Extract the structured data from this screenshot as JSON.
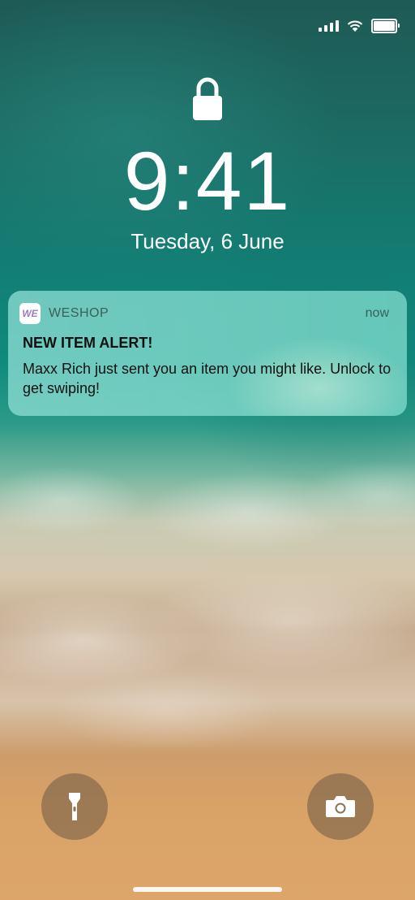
{
  "status_bar": {
    "signal_icon": "cellular-signal-icon",
    "wifi_icon": "wifi-icon",
    "battery_icon": "battery-icon",
    "battery_level": 1.0
  },
  "lock_screen": {
    "lock_icon": "padlock-icon",
    "time": "9:41",
    "date": "Tuesday, 6 June"
  },
  "notification": {
    "app_icon_text": "WE",
    "app_name": "WESHOP",
    "time": "now",
    "title": "NEW ITEM ALERT!",
    "body": "Maxx Rich just sent you an item you might like. Unlock to get swiping!"
  },
  "quick_actions": {
    "flashlight_icon": "flashlight-icon",
    "camera_icon": "camera-icon"
  },
  "colors": {
    "notification_bg": "#7fd6c8",
    "text_primary": "#111111",
    "text_secondary": "#3b5f5a"
  }
}
